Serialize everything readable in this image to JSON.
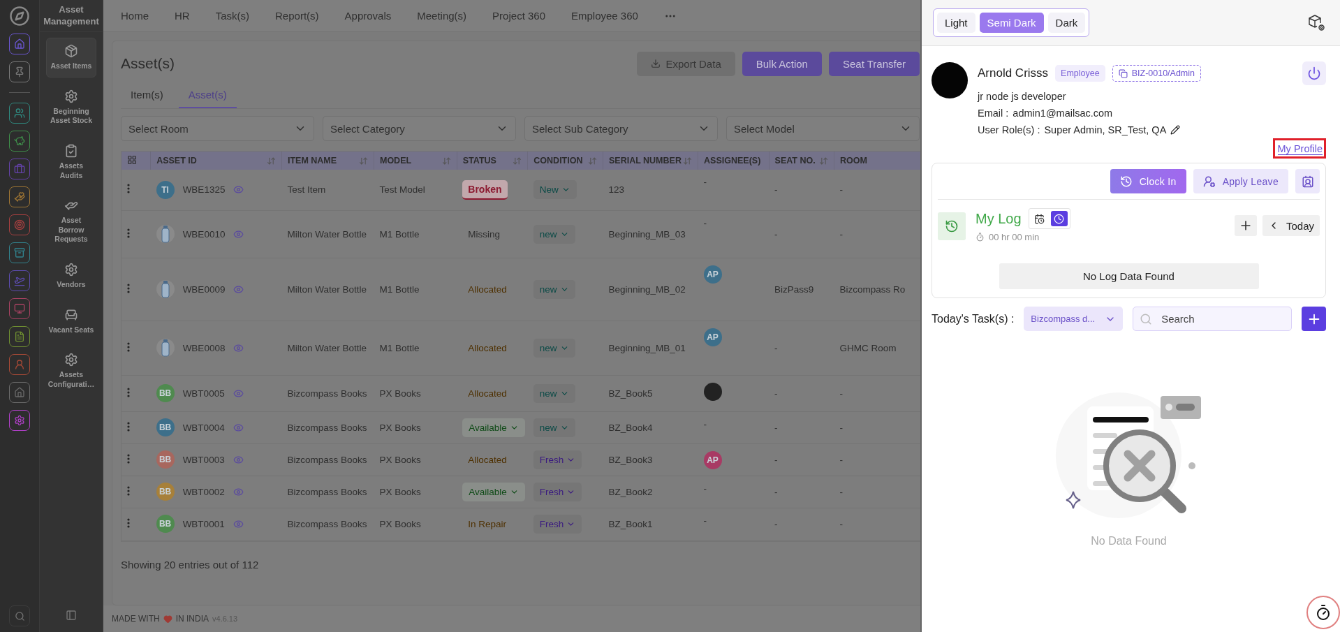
{
  "rail": {
    "items": [
      {
        "color": "#6a56d0"
      },
      {
        "color": "#7a7a7a"
      },
      {
        "color": "#2f8a80"
      },
      {
        "color": "#3f8f4a"
      },
      {
        "color": "#6442a8"
      },
      {
        "color": "#a07634"
      },
      {
        "color": "#a84040"
      },
      {
        "color": "#31838e"
      },
      {
        "color": "#5c4cb0"
      },
      {
        "color": "#a84262"
      },
      {
        "color": "#6f8f31"
      },
      {
        "color": "#a84a36"
      },
      {
        "color": "#6a6a6a"
      },
      {
        "color": "#b040c8"
      }
    ]
  },
  "sidebar": {
    "title": "Asset Management",
    "items": [
      {
        "label": "Asset Items",
        "selected": true
      },
      {
        "label": "Beginning Asset Stock",
        "selected": false
      },
      {
        "label": "Assets Audits",
        "selected": false
      },
      {
        "label": "Asset Borrow Requests",
        "selected": false
      },
      {
        "label": "Vendors",
        "selected": false
      },
      {
        "label": "Vacant Seats",
        "selected": false
      },
      {
        "label": "Assets Configurati…",
        "selected": false
      }
    ]
  },
  "nav": {
    "items": [
      "Home",
      "HR",
      "Task(s)",
      "Report(s)",
      "Approvals",
      "Meeting(s)",
      "Project 360",
      "Employee 360"
    ]
  },
  "page": {
    "title": "Asset(s)",
    "actions": [
      {
        "label": "Export Data",
        "kind": "secondary"
      },
      {
        "label": "Bulk Action",
        "kind": "primary"
      },
      {
        "label": "Seat Transfer",
        "kind": "primary"
      }
    ],
    "tabs": [
      {
        "label": "Item(s)",
        "selected": false
      },
      {
        "label": "Asset(s)",
        "selected": true
      }
    ],
    "filters": [
      {
        "placeholder": "Select Room"
      },
      {
        "placeholder": "Select Category"
      },
      {
        "placeholder": "Select Sub Category"
      },
      {
        "placeholder": "Select Model"
      }
    ]
  },
  "table": {
    "columns": [
      {
        "label": "ASSET ID",
        "sortable": true
      },
      {
        "label": "ITEM NAME",
        "sortable": true
      },
      {
        "label": "MODEL",
        "sortable": true
      },
      {
        "label": "STATUS",
        "sortable": true
      },
      {
        "label": "CONDITION",
        "sortable": true
      },
      {
        "label": "SERIAL NUMBER",
        "sortable": true
      },
      {
        "label": "ASSIGNEE(S)",
        "sortable": false
      },
      {
        "label": "SEAT NO.",
        "sortable": true
      },
      {
        "label": "ROOM",
        "sortable": false
      }
    ],
    "rows": [
      {
        "avatar": {
          "kind": "initials",
          "text": "TI",
          "color": "#3d6f8a"
        },
        "asset_id": "WBE1325",
        "item_name": "Test Item",
        "model": "Test Model",
        "status": {
          "label": "Broken",
          "kind": "badge",
          "color": "#8c1a30"
        },
        "condition": {
          "label": "New",
          "color": "#0a4a46"
        },
        "serial": "123",
        "assignee": {
          "kind": "none",
          "text": "-"
        },
        "seat": "-",
        "room": "-"
      },
      {
        "avatar": {
          "kind": "bottle"
        },
        "asset_id": "WBE0010",
        "item_name": "Milton Water Bottle",
        "model": "M1 Bottle",
        "status": {
          "label": "Missing",
          "kind": "text",
          "color": "#2e2e2e"
        },
        "condition": {
          "label": "new",
          "color": "#0a4a46"
        },
        "serial": "Beginning_MB_03",
        "assignee": {
          "kind": "none",
          "text": "-"
        },
        "seat": "-",
        "room": "-"
      },
      {
        "avatar": {
          "kind": "bottle"
        },
        "asset_id": "WBE0009",
        "item_name": "Milton Water Bottle",
        "model": "M1 Bottle",
        "status": {
          "label": "Allocated",
          "kind": "text",
          "color": "#4e3000"
        },
        "condition": {
          "label": "new",
          "color": "#0a4a46"
        },
        "serial": "Beginning_MB_02",
        "assignee": {
          "kind": "initials",
          "text": "AP",
          "color": "#3d6f8a"
        },
        "seat": "BizPass9",
        "room": "Bizcompass Ro"
      },
      {
        "avatar": {
          "kind": "bottle"
        },
        "asset_id": "WBE0008",
        "item_name": "Milton Water Bottle",
        "model": "M1 Bottle",
        "status": {
          "label": "Allocated",
          "kind": "text",
          "color": "#4e3000"
        },
        "condition": {
          "label": "new",
          "color": "#0a4a46"
        },
        "serial": "Beginning_MB_01",
        "assignee": {
          "kind": "initials",
          "text": "AP",
          "color": "#3d6f8a"
        },
        "seat": "-",
        "room": "GHMC Room"
      },
      {
        "avatar": {
          "kind": "initials",
          "text": "BB",
          "color": "#4f8a4f"
        },
        "asset_id": "WBT0005",
        "item_name": "Bizcompass Books",
        "model": "PX Books",
        "status": {
          "label": "Allocated",
          "kind": "text",
          "color": "#4e3000"
        },
        "condition": {
          "label": "new",
          "color": "#0a4a46"
        },
        "serial": "BZ_Book5",
        "assignee": {
          "kind": "photo"
        },
        "seat": "-",
        "room": "-"
      },
      {
        "avatar": {
          "kind": "initials",
          "text": "BB",
          "color": "#3d6f8a"
        },
        "asset_id": "WBT0004",
        "item_name": "Bizcompass Books",
        "model": "PX Books",
        "status": {
          "label": "Available",
          "kind": "dropdown",
          "color": "#0e4a16"
        },
        "condition": {
          "label": "new",
          "color": "#0a4a46"
        },
        "serial": "BZ_Book4",
        "assignee": {
          "kind": "none",
          "text": "-"
        },
        "seat": "-",
        "room": "-"
      },
      {
        "avatar": {
          "kind": "initials",
          "text": "BB",
          "color": "#a8675e"
        },
        "asset_id": "WBT0003",
        "item_name": "Bizcompass Books",
        "model": "PX Books",
        "status": {
          "label": "Allocated",
          "kind": "text",
          "color": "#4e3000"
        },
        "condition": {
          "label": "Fresh",
          "color": "#3a1a80"
        },
        "serial": "BZ_Book3",
        "assignee": {
          "kind": "initials",
          "text": "AP",
          "color": "#a83a64"
        },
        "seat": "-",
        "room": "-"
      },
      {
        "avatar": {
          "kind": "initials",
          "text": "BB",
          "color": "#a7803a"
        },
        "asset_id": "WBT0002",
        "item_name": "Bizcompass Books",
        "model": "PX Books",
        "status": {
          "label": "Available",
          "kind": "dropdown",
          "color": "#0e4a16"
        },
        "condition": {
          "label": "Fresh",
          "color": "#3a1a80"
        },
        "serial": "BZ_Book2",
        "assignee": {
          "kind": "none",
          "text": "-"
        },
        "seat": "-",
        "room": "-"
      },
      {
        "avatar": {
          "kind": "initials",
          "text": "BB",
          "color": "#4f8a4f"
        },
        "asset_id": "WBT0001",
        "item_name": "Bizcompass Books",
        "model": "PX Books",
        "status": {
          "label": "In Repair",
          "kind": "text",
          "color": "#4e3000"
        },
        "condition": {
          "label": "Fresh",
          "color": "#3a1a80"
        },
        "serial": "BZ_Book1",
        "assignee": {
          "kind": "none",
          "text": "-"
        },
        "seat": "-",
        "room": "-"
      }
    ],
    "summary": "Showing 20 entries out of 112"
  },
  "footer": {
    "before": "MADE WITH",
    "after": "IN INDIA",
    "version": "v4.6.13"
  },
  "drawer": {
    "themes": [
      {
        "label": "Light",
        "selected": false
      },
      {
        "label": "Semi Dark",
        "selected": true
      },
      {
        "label": "Dark",
        "selected": false
      }
    ],
    "profile": {
      "name": "Arnold Crisss",
      "badge": "Employee",
      "code": "BIZ-0010/Admin",
      "designation": "jr node js developer",
      "email_label": "Email :",
      "email": "admin1@mailsac.com",
      "roles_label": "User Role(s) :",
      "roles": "Super Admin, SR_Test, QA",
      "link": "My Profile"
    },
    "log": {
      "actions": [
        {
          "label": "Clock In",
          "kind": "primary"
        },
        {
          "label": "Apply Leave",
          "kind": "secondary"
        }
      ],
      "title": "My Log",
      "views": [
        {
          "selected": false
        },
        {
          "selected": true
        }
      ],
      "duration": "00 hr 00 min",
      "date": "Today",
      "empty": "No Log Data Found"
    },
    "tasks": {
      "label": "Today's Task(s) :",
      "project": "Bizcompass d...",
      "search": {
        "placeholder": "Search"
      },
      "empty": "No Data Found"
    }
  }
}
